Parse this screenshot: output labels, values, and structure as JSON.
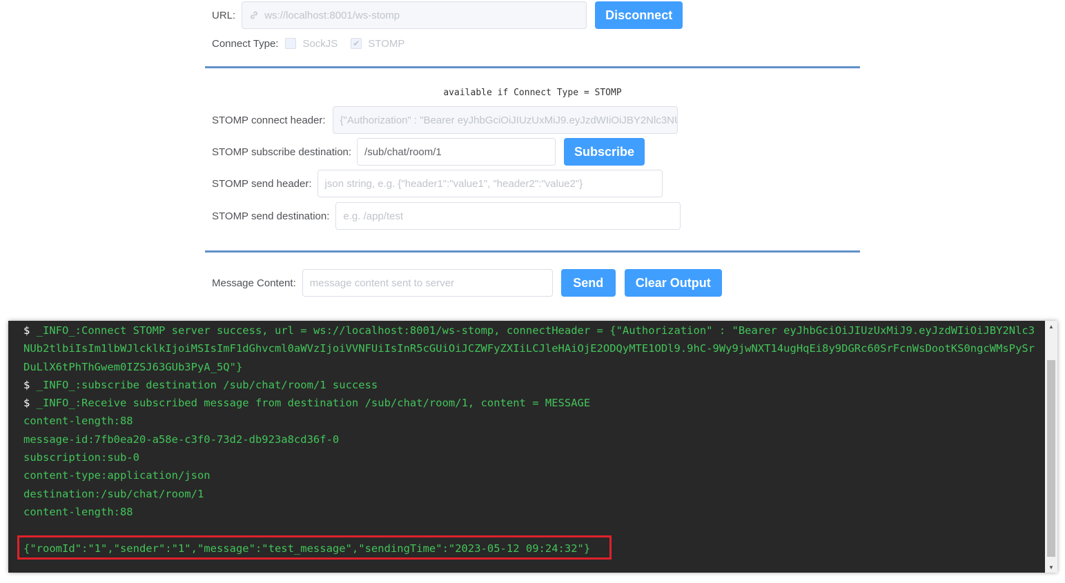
{
  "url": {
    "label": "URL:",
    "value": "ws://localhost:8001/ws-stomp",
    "disconnect_label": "Disconnect"
  },
  "connect_type": {
    "label": "Connect Type:",
    "options": [
      {
        "label": "SockJS",
        "checked": false
      },
      {
        "label": "STOMP",
        "checked": true
      }
    ]
  },
  "note": "available if Connect Type = STOMP",
  "stomp": {
    "connect_header_label": "STOMP connect header:",
    "connect_header_value": "{\"Authorization\" : \"Bearer eyJhbGciOiJIUzUxMiJ9.eyJzdWIiOiJBY2Nlc3NUb2tlbiIsIm1lbWJlcklkIjoiMSIsImF1dGhvcml0aWVzIjoiVVNFUiIsInR5cGUiOiJCZWFyZXIiLCJleHAiOjE2ODQyMTE1ODl9.9hC-9Wy9jwNXT14ugHqEi8y9DGRc60SrFcnWsDootKS0ngcWMsPySrDuLlX6tPhThGwem0IZSJ63GUb3PyA_5Q\"}",
    "subscribe_label": "STOMP subscribe destination:",
    "subscribe_value": "/sub/chat/room/1",
    "subscribe_button": "Subscribe",
    "send_header_label": "STOMP send header:",
    "send_header_placeholder": "json string, e.g. {\"header1\":\"value1\", \"header2\":\"value2\"}",
    "send_dest_label": "STOMP send destination:",
    "send_dest_placeholder": "e.g. /app/test"
  },
  "message": {
    "label": "Message Content:",
    "placeholder": "message content sent to server",
    "send_button": "Send",
    "clear_button": "Clear Output"
  },
  "console": {
    "lines": [
      {
        "prompt": "$ ",
        "text": "_INFO_:Connect STOMP server success, url = ws://localhost:8001/ws-stomp, connectHeader = {\"Authorization\" : \"Bearer eyJhbGciOiJIUzUxMiJ9.eyJzdWIiOiJBY2Nlc3NUb2tlbiIsIm1lbWJlcklkIjoiMSIsImF1dGhvcml0aWVzIjoiVVNFUiIsInR5cGUiOiJCZWFyZXIiLCJleHAiOjE2ODQyMTE1ODl9.9hC-9Wy9jwNXT14ugHqEi8y9DGRc60SrFcnWsDootKS0ngcWMsPySrDuLlX6tPhThGwem0IZSJ63GUb3PyA_5Q\"}"
      },
      {
        "prompt": "$ ",
        "text": "_INFO_:subscribe destination /sub/chat/room/1 success"
      },
      {
        "prompt": "$ ",
        "text": "_INFO_:Receive subscribed message from destination /sub/chat/room/1, content = MESSAGE"
      },
      {
        "prompt": "",
        "text": "content-length:88"
      },
      {
        "prompt": "",
        "text": "message-id:7fb0ea20-a58e-c3f0-73d2-db923a8cd36f-0"
      },
      {
        "prompt": "",
        "text": "subscription:sub-0"
      },
      {
        "prompt": "",
        "text": "content-type:application/json"
      },
      {
        "prompt": "",
        "text": "destination:/sub/chat/room/1"
      },
      {
        "prompt": "",
        "text": "content-length:88"
      },
      {
        "prompt": "",
        "text": ""
      },
      {
        "prompt": "",
        "text": "{\"roomId\":\"1\",\"sender\":\"1\",\"message\":\"test_message\",\"sendingTime\":\"2023-05-12 09:24:32\"}"
      }
    ]
  },
  "colors": {
    "accent": "#409eff",
    "divider": "#6190c8",
    "console_bg": "#282828",
    "console_text": "#43c45a",
    "highlight": "#e0212a"
  },
  "icons": {
    "url_prefix": "link-icon",
    "checkbox_checked": "check-icon"
  }
}
